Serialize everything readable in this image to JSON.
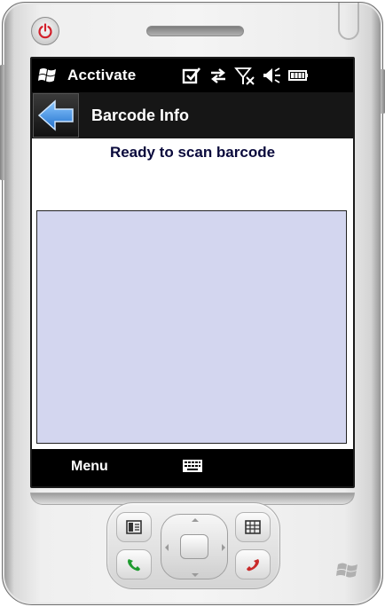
{
  "status_bar": {
    "title": "Acctivate",
    "icons": [
      "start-flag-icon",
      "checkbox-icon",
      "sync-arrows-icon",
      "no-signal-icon",
      "speaker-muted-icon",
      "battery-icon"
    ]
  },
  "title_bar": {
    "back_icon": "back-arrow-icon",
    "title": "Barcode Info"
  },
  "main": {
    "scan_status": "Ready to scan barcode",
    "barcode_area_color": "#d3d6ef"
  },
  "softkeys": {
    "left_label": "Menu",
    "center_icon": "keyboard-icon"
  },
  "hardware": {
    "buttons": [
      "power-icon",
      "soft-key-left-icon",
      "soft-key-right-icon",
      "call-icon",
      "end-call-icon",
      "windows-logo-icon"
    ]
  },
  "colors": {
    "screen_background": "#ffffff",
    "status_bar": "#000000",
    "title_bar": "#161616",
    "scan_text": "#0a0a3c",
    "back_arrow": "#2f8be0"
  }
}
